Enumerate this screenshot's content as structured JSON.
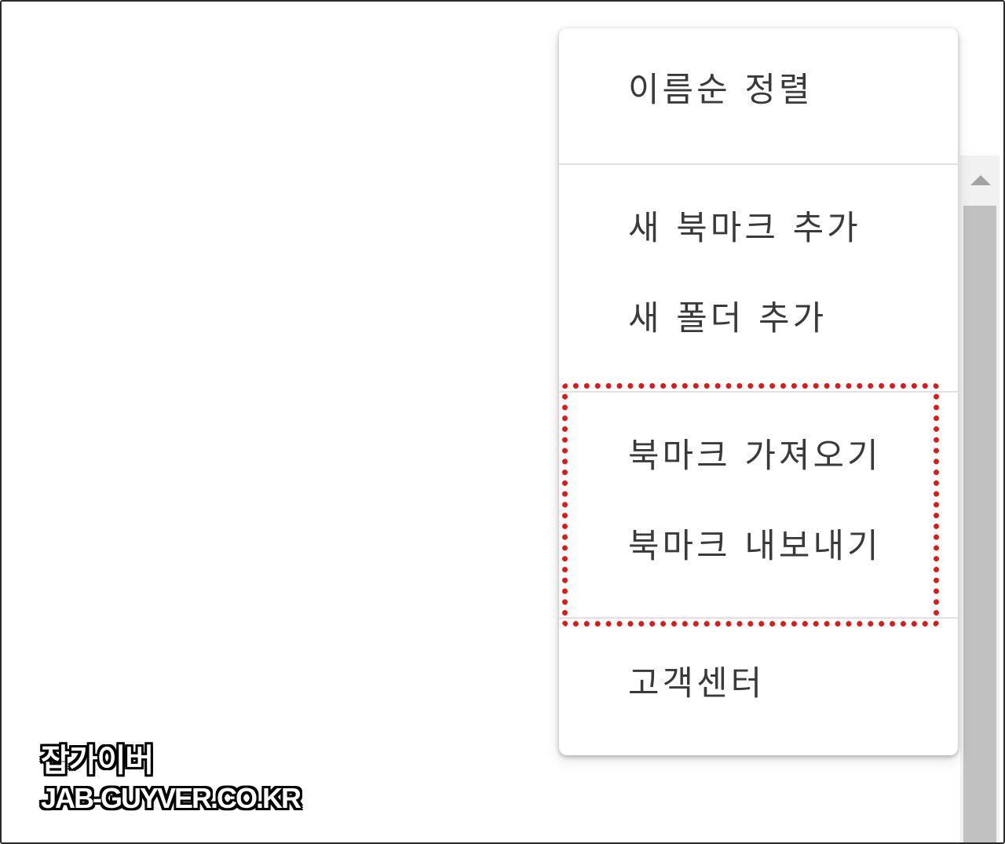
{
  "menu": {
    "items": [
      {
        "label": "이름순 정렬"
      },
      {
        "label": "새 북마크 추가"
      },
      {
        "label": "새 폴더 추가"
      },
      {
        "label": "북마크 가져오기"
      },
      {
        "label": "북마크 내보내기"
      },
      {
        "label": "고객센터"
      }
    ]
  },
  "scrollbar": {
    "up_icon": "triangle-up-icon"
  },
  "highlight": {
    "color": "#e01818"
  },
  "watermark": {
    "line1": "잡가이버",
    "line2": "JAB-GUYVER.CO.KR"
  }
}
